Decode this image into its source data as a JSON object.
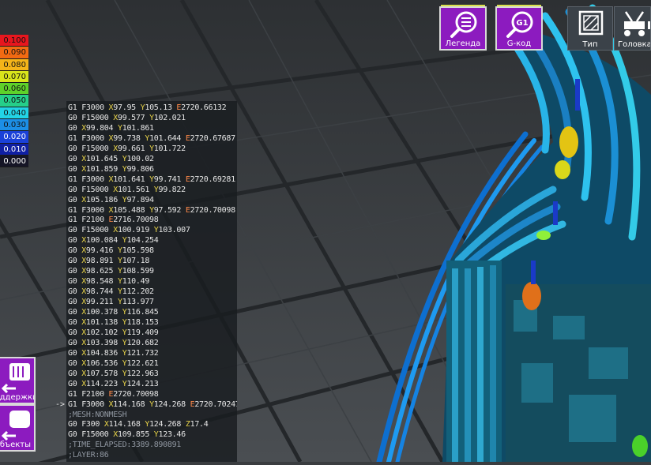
{
  "legend": {
    "items": [
      {
        "label": "0.100",
        "color": "#e8161e"
      },
      {
        "label": "0.090",
        "color": "#f26a12"
      },
      {
        "label": "0.080",
        "color": "#f4b419"
      },
      {
        "label": "0.070",
        "color": "#d8e41b"
      },
      {
        "label": "0.060",
        "color": "#5ed12a"
      },
      {
        "label": "0.050",
        "color": "#25cf8a"
      },
      {
        "label": "0.040",
        "color": "#22d4e6"
      },
      {
        "label": "0.030",
        "color": "#1c8fe6"
      },
      {
        "label": "0.020",
        "color": "#1a41d8"
      },
      {
        "label": "0.010",
        "color": "#0f1fa3"
      },
      {
        "label": "0.000",
        "color": "#151526"
      }
    ]
  },
  "toolbar": {
    "legend_label": "Легенда",
    "gcode_label": "G-код",
    "type_label": "Тип",
    "head_label": "Головка"
  },
  "side": {
    "supports_label": "Поддержки",
    "objects_label": "Объекты"
  },
  "gcode": {
    "current_marker": "->",
    "lines": [
      {
        "cmd": "G1",
        "params": [
          [
            "F",
            "3000"
          ],
          [
            "X",
            "97.95"
          ],
          [
            "Y",
            "105.13"
          ],
          [
            "E",
            "2720.66132"
          ]
        ]
      },
      {
        "cmd": "G0",
        "params": [
          [
            "F",
            "15000"
          ],
          [
            "X",
            "99.577"
          ],
          [
            "Y",
            "102.021"
          ]
        ]
      },
      {
        "cmd": "G0",
        "params": [
          [
            "X",
            "99.804"
          ],
          [
            "Y",
            "101.861"
          ]
        ]
      },
      {
        "cmd": "G1",
        "params": [
          [
            "F",
            "3000"
          ],
          [
            "X",
            "99.738"
          ],
          [
            "Y",
            "101.644"
          ],
          [
            "E",
            "2720.67687"
          ]
        ]
      },
      {
        "cmd": "G0",
        "params": [
          [
            "F",
            "15000"
          ],
          [
            "X",
            "99.661"
          ],
          [
            "Y",
            "101.722"
          ]
        ]
      },
      {
        "cmd": "G0",
        "params": [
          [
            "X",
            "101.645"
          ],
          [
            "Y",
            "100.02"
          ]
        ]
      },
      {
        "cmd": "G0",
        "params": [
          [
            "X",
            "101.859"
          ],
          [
            "Y",
            "99.806"
          ]
        ]
      },
      {
        "cmd": "G1",
        "params": [
          [
            "F",
            "3000"
          ],
          [
            "X",
            "101.641"
          ],
          [
            "Y",
            "99.741"
          ],
          [
            "E",
            "2720.69281"
          ]
        ]
      },
      {
        "cmd": "G0",
        "params": [
          [
            "F",
            "15000"
          ],
          [
            "X",
            "101.561"
          ],
          [
            "Y",
            "99.822"
          ]
        ]
      },
      {
        "cmd": "G0",
        "params": [
          [
            "X",
            "105.186"
          ],
          [
            "Y",
            "97.894"
          ]
        ]
      },
      {
        "cmd": "G1",
        "params": [
          [
            "F",
            "3000"
          ],
          [
            "X",
            "105.488"
          ],
          [
            "Y",
            "97.592"
          ],
          [
            "E",
            "2720.70098"
          ]
        ]
      },
      {
        "cmd": "G1",
        "params": [
          [
            "F",
            "2100"
          ],
          [
            "E",
            "2716.70098"
          ]
        ]
      },
      {
        "cmd": "G0",
        "params": [
          [
            "F",
            "15000"
          ],
          [
            "X",
            "100.919"
          ],
          [
            "Y",
            "103.007"
          ]
        ]
      },
      {
        "cmd": "G0",
        "params": [
          [
            "X",
            "100.084"
          ],
          [
            "Y",
            "104.254"
          ]
        ]
      },
      {
        "cmd": "G0",
        "params": [
          [
            "X",
            "99.416"
          ],
          [
            "Y",
            "105.598"
          ]
        ]
      },
      {
        "cmd": "G0",
        "params": [
          [
            "X",
            "98.891"
          ],
          [
            "Y",
            "107.18"
          ]
        ]
      },
      {
        "cmd": "G0",
        "params": [
          [
            "X",
            "98.625"
          ],
          [
            "Y",
            "108.599"
          ]
        ]
      },
      {
        "cmd": "G0",
        "params": [
          [
            "X",
            "98.548"
          ],
          [
            "Y",
            "110.49"
          ]
        ]
      },
      {
        "cmd": "G0",
        "params": [
          [
            "X",
            "98.744"
          ],
          [
            "Y",
            "112.202"
          ]
        ]
      },
      {
        "cmd": "G0",
        "params": [
          [
            "X",
            "99.211"
          ],
          [
            "Y",
            "113.977"
          ]
        ]
      },
      {
        "cmd": "G0",
        "params": [
          [
            "X",
            "100.378"
          ],
          [
            "Y",
            "116.845"
          ]
        ]
      },
      {
        "cmd": "G0",
        "params": [
          [
            "X",
            "101.138"
          ],
          [
            "Y",
            "118.153"
          ]
        ]
      },
      {
        "cmd": "G0",
        "params": [
          [
            "X",
            "102.102"
          ],
          [
            "Y",
            "119.409"
          ]
        ]
      },
      {
        "cmd": "G0",
        "params": [
          [
            "X",
            "103.398"
          ],
          [
            "Y",
            "120.682"
          ]
        ]
      },
      {
        "cmd": "G0",
        "params": [
          [
            "X",
            "104.836"
          ],
          [
            "Y",
            "121.732"
          ]
        ]
      },
      {
        "cmd": "G0",
        "params": [
          [
            "X",
            "106.536"
          ],
          [
            "Y",
            "122.621"
          ]
        ]
      },
      {
        "cmd": "G0",
        "params": [
          [
            "X",
            "107.578"
          ],
          [
            "Y",
            "122.963"
          ]
        ]
      },
      {
        "cmd": "G0",
        "params": [
          [
            "X",
            "114.223"
          ],
          [
            "Y",
            "124.213"
          ]
        ]
      },
      {
        "cmd": "G1",
        "params": [
          [
            "F",
            "2100"
          ],
          [
            "E",
            "2720.70098"
          ]
        ]
      },
      {
        "cmd": "G1",
        "current": true,
        "params": [
          [
            "F",
            "3000"
          ],
          [
            "X",
            "114.168"
          ],
          [
            "Y",
            "124.268"
          ],
          [
            "E",
            "2720.70247"
          ]
        ]
      },
      {
        "comment": ";MESH:NONMESH"
      },
      {
        "cmd": "G0",
        "params": [
          [
            "F",
            "300"
          ],
          [
            "X",
            "114.168"
          ],
          [
            "Y",
            "124.268"
          ],
          [
            "Z",
            "17.4"
          ]
        ]
      },
      {
        "cmd": "G0",
        "params": [
          [
            "F",
            "15000"
          ],
          [
            "X",
            "109.855"
          ],
          [
            "Y",
            "123.46"
          ]
        ]
      },
      {
        "comment": ";TIME_ELAPSED:3389.890891"
      },
      {
        "comment": ";LAYER:86"
      }
    ]
  }
}
